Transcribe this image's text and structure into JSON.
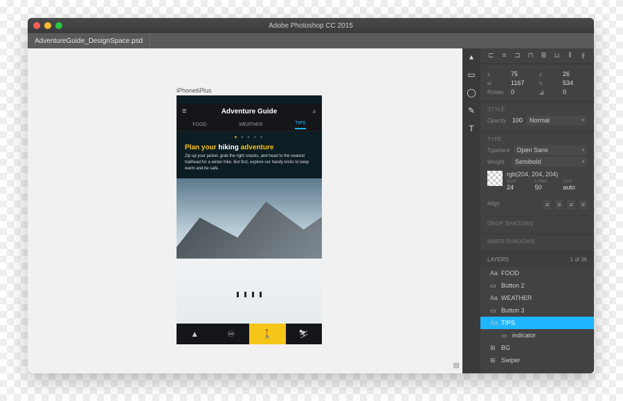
{
  "window": {
    "title": "Adobe Photoshop CC 2015",
    "tab": "AdventureGuide_DesignSpace.psd"
  },
  "artboard": {
    "label": "iPhone6Plus",
    "header_title": "Adventure Guide",
    "tabs": [
      "FOOD",
      "WEATHER",
      "TIPS"
    ],
    "active_tab_index": 2,
    "hero_pre": "Plan your",
    "hero_mid": "hiking",
    "hero_accent": "adventure",
    "hero_body": "Zip up your jacket, grab the right snacks, and head to the nearest trailhead for a winter hike. But first, explore our handy tricks to keep warm and be safe."
  },
  "tools": [
    "move",
    "rect",
    "ellipse",
    "pen",
    "type"
  ],
  "transform": {
    "x": "75",
    "y": "26",
    "w": "1167",
    "h": "534",
    "rotate": "0",
    "skew": "0"
  },
  "style": {
    "section": "STYLE",
    "opacity_label": "Opacity",
    "opacity": "100",
    "blend": "Normal"
  },
  "type": {
    "section": "TYPE",
    "typeface_label": "Typeface",
    "typeface": "Open Sans",
    "weight_label": "Weight",
    "weight": "Semibold",
    "color": "rgb(204, 204, 204)",
    "size_label": "Size",
    "size": "24",
    "letter_label": "Letter",
    "letter": "50",
    "line_label": "Line",
    "line": "auto",
    "align_label": "Align"
  },
  "shadows": {
    "drop": "DROP SHADOWS",
    "inner": "INNER SHADOWS"
  },
  "layers": {
    "title": "LAYERS",
    "count_current": "1",
    "count_of": "of",
    "count_total": "36",
    "items": [
      {
        "icon": "Aa",
        "name": "FOOD"
      },
      {
        "icon": "▭",
        "name": "Button 2"
      },
      {
        "icon": "Aa",
        "name": "WEATHER"
      },
      {
        "icon": "▭",
        "name": "Button 3"
      },
      {
        "icon": "Aa",
        "name": "TIPS",
        "selected": true
      },
      {
        "icon": "▭",
        "name": "indicator",
        "indent": true
      },
      {
        "icon": "⊞",
        "name": "BG"
      },
      {
        "icon": "⊞",
        "name": "Swiper"
      }
    ]
  }
}
